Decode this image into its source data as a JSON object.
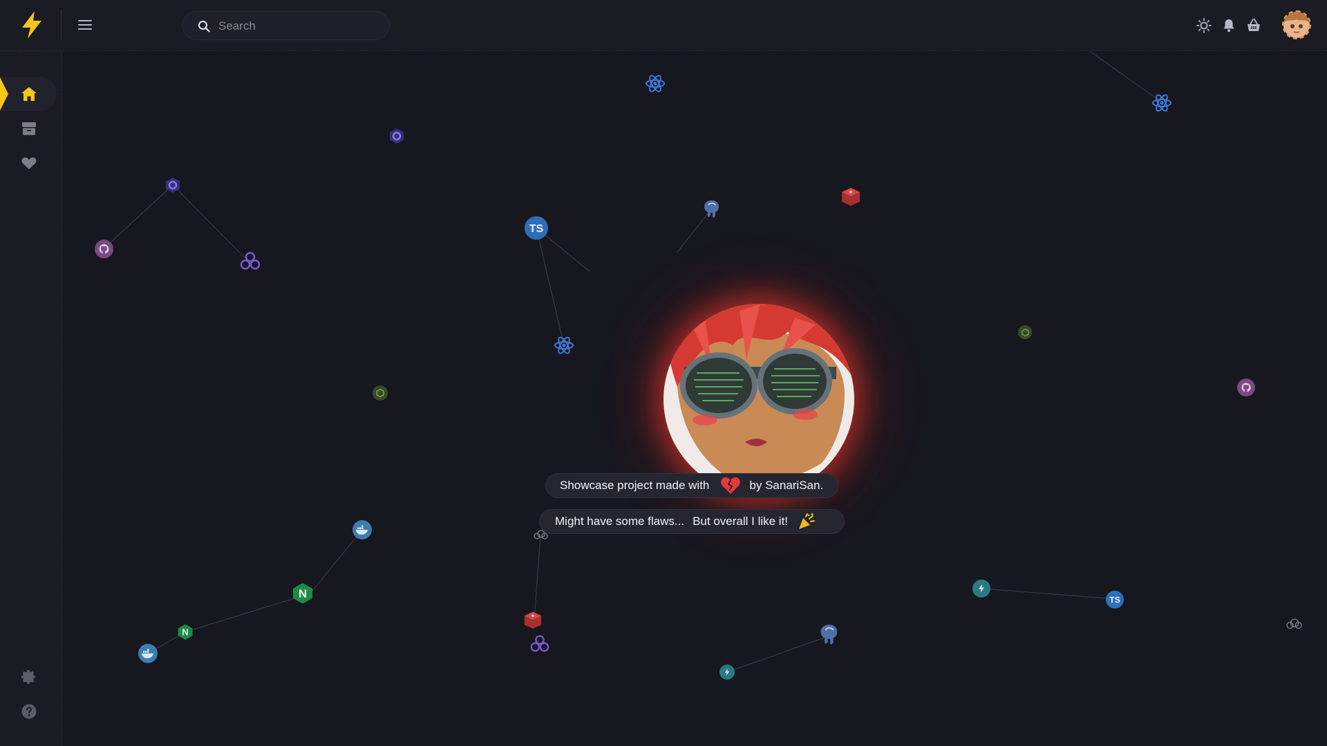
{
  "search": {
    "placeholder": "Search"
  },
  "header": {
    "icons": [
      "sun-icon",
      "bell-icon",
      "basket-icon",
      "avatar"
    ]
  },
  "sidebar": {
    "items": [
      "home-icon",
      "box-icon",
      "heart-icon"
    ],
    "bottom_items": [
      "gear-icon",
      "help-icon"
    ]
  },
  "showcase": {
    "line1_before": "Showcase project made with",
    "line1_after": "by SanariSan.",
    "line2_part1": "Might have some flaws...",
    "line2_part2": "But overall I like it!"
  },
  "colors": {
    "background": "#17171f",
    "panel": "#1b1b24",
    "accent": "#f5c518",
    "hero_glow": "#ff3c28"
  },
  "tech_icons": [
    "react",
    "typescript",
    "postgresql",
    "redis",
    "github",
    "graphql",
    "nginx",
    "docker",
    "nodejs",
    "apollo",
    "mongodb",
    "lightning",
    "cloud"
  ]
}
